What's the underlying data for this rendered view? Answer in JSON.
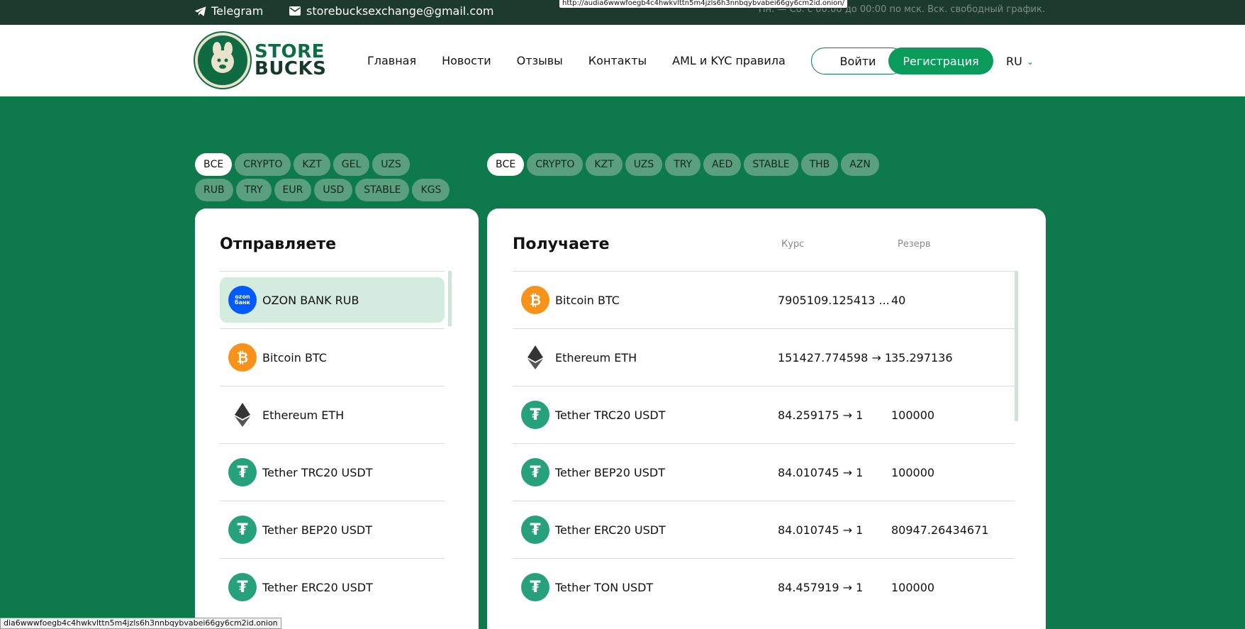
{
  "topbar": {
    "telegram": "Telegram",
    "email": "storebucksexchange@gmail.com",
    "hours": "Пн. — Сб. с 00:00 до 00:00 по мск. Вск. свободный график.",
    "url_tooltip": "http://audia6wwwfoegb4c4hwkvlttn5m4jzls6h3nnbqybvabei66gy6cm2id.onion/"
  },
  "header": {
    "logo_line1": "STORE",
    "logo_line2": "BUCKS",
    "nav": [
      "Главная",
      "Новости",
      "Отзывы",
      "Контакты",
      "AML и KYC правила"
    ],
    "login": "Войти",
    "register": "Регистрация",
    "lang": "RU"
  },
  "filters_send": [
    "ВСЕ",
    "CRYPTO",
    "KZT",
    "GEL",
    "UZS",
    "RUB",
    "TRY",
    "EUR",
    "USD",
    "STABLE",
    "KGS"
  ],
  "filters_receive": [
    "ВСЕ",
    "CRYPTO",
    "KZT",
    "UZS",
    "TRY",
    "AED",
    "STABLE",
    "THB",
    "AZN"
  ],
  "send": {
    "title": "Отправляете",
    "items": [
      {
        "name": "OZON BANK RUB",
        "icon": "ozon-bank-icon"
      },
      {
        "name": "Bitcoin BTC",
        "icon": "bitcoin-icon"
      },
      {
        "name": "Ethereum ETH",
        "icon": "ethereum-icon"
      },
      {
        "name": "Tether TRC20 USDT",
        "icon": "tether-icon"
      },
      {
        "name": "Tether BEP20 USDT",
        "icon": "tether-icon"
      },
      {
        "name": "Tether ERC20 USDT",
        "icon": "tether-icon"
      }
    ]
  },
  "receive": {
    "title": "Получаете",
    "col_rate": "Курс",
    "col_reserve": "Резерв",
    "items": [
      {
        "name": "Bitcoin BTC",
        "rate": "7905109.125413 ...",
        "reserve": "40"
      },
      {
        "name": "Ethereum ETH",
        "rate": "151427.774598 → 1",
        "reserve": "35.297136"
      },
      {
        "name": "Tether TRC20 USDT",
        "rate": "84.259175 → 1",
        "reserve": "100000"
      },
      {
        "name": "Tether BEP20 USDT",
        "rate": "84.010745 → 1",
        "reserve": "100000"
      },
      {
        "name": "Tether ERC20 USDT",
        "rate": "84.010745 → 1",
        "reserve": "80947.26434671"
      },
      {
        "name": "Tether TON USDT",
        "rate": "84.457919 → 1",
        "reserve": "100000"
      }
    ]
  },
  "status_url": "dia6wwwfoegb4c4hwkvlttn5m4jzls6h3nnbqybvabei66gy6cm2id.onion",
  "colors": {
    "brand_green": "#0e7a4c",
    "accent": "#0a9a5a",
    "topbar": "#1c3a2e"
  }
}
